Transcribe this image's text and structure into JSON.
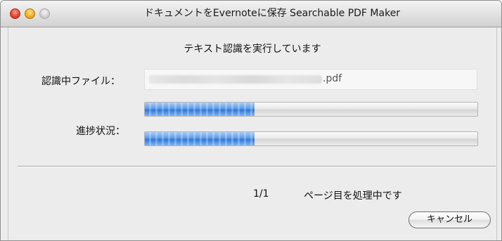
{
  "window": {
    "title": "ドキュメントをEvernoteに保存 Searchable PDF Maker"
  },
  "dialog": {
    "heading": "テキスト認識を実行しています",
    "file_label": "認識中ファイル：",
    "file_extension": ".pdf",
    "progress_label": "進捗状況：",
    "progress_bars": [
      {
        "fraction": 0.33
      },
      {
        "fraction": 0.33
      }
    ],
    "page_count": "1/1",
    "page_status": "ページ目を処理中です",
    "cancel_label": "キャンセル"
  },
  "colors": {
    "progress_fill": "#2e78da",
    "close_button": "#e0412f",
    "minimize_button": "#f0aa1e"
  },
  "icons": [
    "close-button",
    "minimize-button",
    "zoom-button"
  ]
}
